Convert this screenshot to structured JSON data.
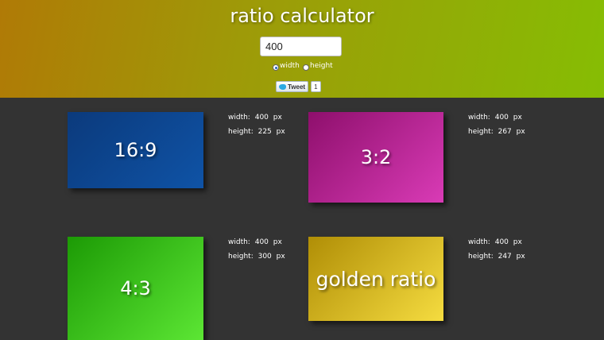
{
  "header": {
    "title": "ratio calculator",
    "input_value": "400",
    "radio": {
      "width_label": "width",
      "height_label": "height",
      "selected": "width"
    },
    "tweet": {
      "label": "Tweet",
      "count": "1"
    },
    "colors": {
      "gradient_start": "#b07a06",
      "gradient_end": "#86bd04"
    }
  },
  "main": {
    "background": "#333333",
    "units": "px",
    "width_label": "width:",
    "height_label": "height:",
    "ratios": [
      {
        "label": "16:9",
        "width": "400",
        "height": "225",
        "color": "#0f53a6"
      },
      {
        "label": "3:2",
        "width": "400",
        "height": "267",
        "color": "#d93bb6"
      },
      {
        "label": "4:3",
        "width": "400",
        "height": "300",
        "color": "#5ce634"
      },
      {
        "label": "golden ratio",
        "width": "400",
        "height": "247",
        "color": "#f5dc40"
      }
    ]
  }
}
